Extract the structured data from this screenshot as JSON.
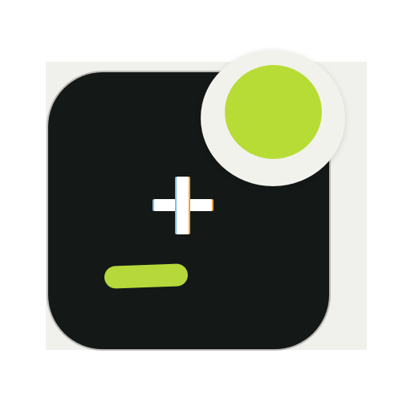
{
  "app_icon": {
    "tile_color": "#141817",
    "plus_color": "#ffffff",
    "minus_color": "#b6d83a",
    "badge_ring_color": "#f1f2ec",
    "badge_dot_color": "#b8dc36",
    "plus_icon_name": "plus-icon",
    "minus_icon_name": "minus-icon",
    "badge_icon_name": "status-dot-icon"
  }
}
